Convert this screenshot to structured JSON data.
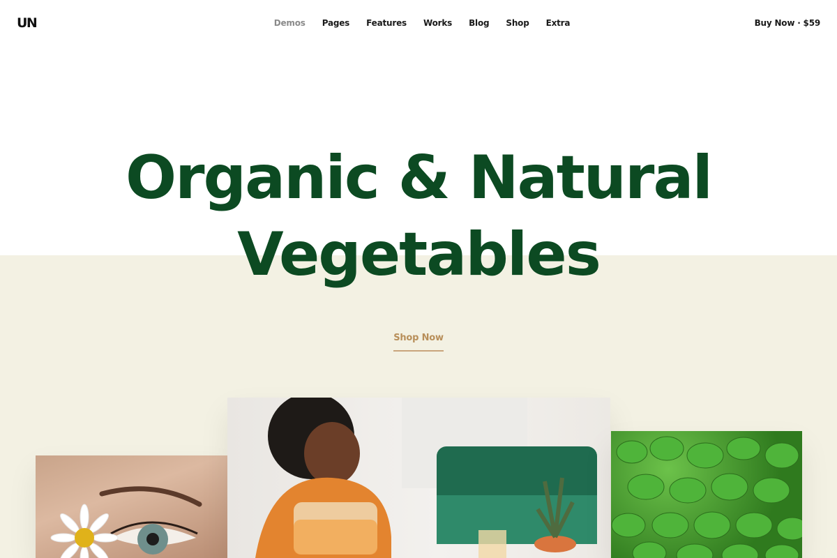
{
  "header": {
    "logo": "UN",
    "nav": [
      "Demos",
      "Pages",
      "Features",
      "Works",
      "Blog",
      "Shop",
      "Extra"
    ],
    "active_nav": "Demos",
    "buy_label": "Buy Now · $59"
  },
  "hero": {
    "headline_line1": "Organic & Natural",
    "headline_line2": "Vegetables",
    "cta_label": "Shop Now"
  },
  "colors": {
    "headline": "#0c4a22",
    "cta": "#b88f5a",
    "hero_background": "#f3f1e3"
  },
  "images": [
    {
      "name": "photo-eye-daisy"
    },
    {
      "name": "photo-woman-pouring-juice"
    },
    {
      "name": "photo-green-leaves"
    }
  ]
}
